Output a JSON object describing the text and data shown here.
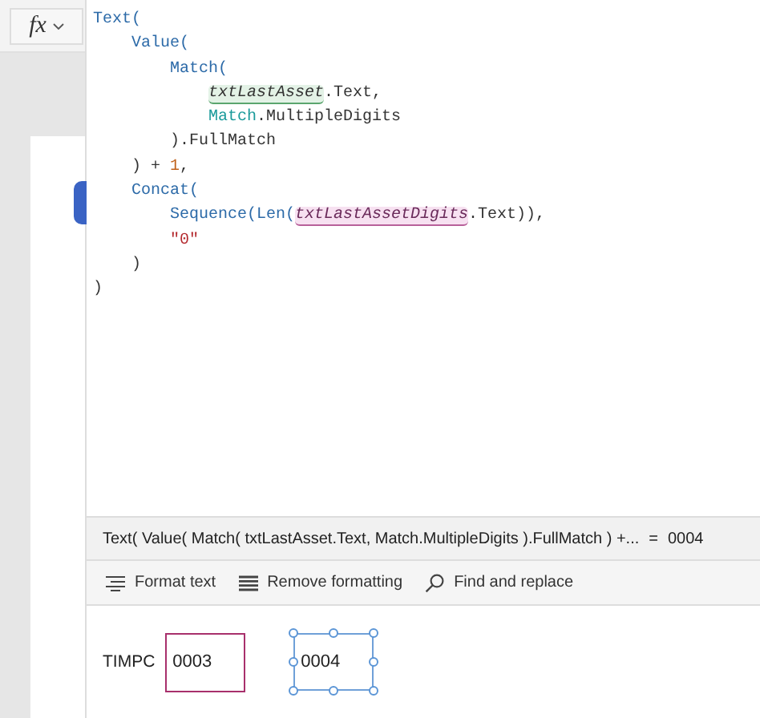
{
  "formula_bar": {
    "fx_label": "fx",
    "code_lines": [
      {
        "tokens": [
          {
            "text": "Text(",
            "kind": "func"
          }
        ],
        "children": [
          {
            "tokens": [
              {
                "text": "Value(",
                "kind": "func"
              }
            ],
            "children": [
              {
                "tokens": [
                  {
                    "text": "Match(",
                    "kind": "func"
                  }
                ],
                "children": [
                  {
                    "tokens": [
                      {
                        "text": "txtLastAsset",
                        "kind": "ref_green"
                      },
                      {
                        "text": ".Text,",
                        "kind": "plain"
                      }
                    ]
                  },
                  {
                    "tokens": [
                      {
                        "text": "Match",
                        "kind": "enum"
                      },
                      {
                        "text": ".MultipleDigits",
                        "kind": "plain"
                      }
                    ]
                  }
                ]
              },
              {
                "tokens": [
                  {
                    "text": ").FullMatch",
                    "kind": "plain"
                  }
                ]
              }
            ]
          },
          {
            "tokens": [
              {
                "text": ") + ",
                "kind": "plain"
              },
              {
                "text": "1",
                "kind": "number"
              },
              {
                "text": ",",
                "kind": "plain"
              }
            ]
          },
          {
            "tokens": [
              {
                "text": "Concat(",
                "kind": "func"
              }
            ],
            "children": [
              {
                "tokens": [
                  {
                    "text": "Sequence(Len(",
                    "kind": "func"
                  },
                  {
                    "text": "txtLastAssetDigits",
                    "kind": "ref_pink"
                  },
                  {
                    "text": ".Text)),",
                    "kind": "plain"
                  }
                ]
              },
              {
                "tokens": [
                  {
                    "text": "\"0\"",
                    "kind": "string"
                  }
                ]
              }
            ]
          },
          {
            "tokens": [
              {
                "text": ")",
                "kind": "plain"
              }
            ]
          }
        ]
      },
      {
        "tokens": [
          {
            "text": ")",
            "kind": "plain"
          }
        ]
      }
    ],
    "result": {
      "expression": "Text( Value( Match( txtLastAsset.Text, Match.MultipleDigits ).FullMatch ) +...",
      "equals": "=",
      "value": "0004"
    },
    "toolbar": [
      {
        "label": "Format text"
      },
      {
        "label": "Remove formatting"
      },
      {
        "label": "Find and replace"
      }
    ]
  },
  "canvas": {
    "label": "TIMPC",
    "input_value": "0003",
    "output_value": "0004",
    "output_selected": true
  }
}
